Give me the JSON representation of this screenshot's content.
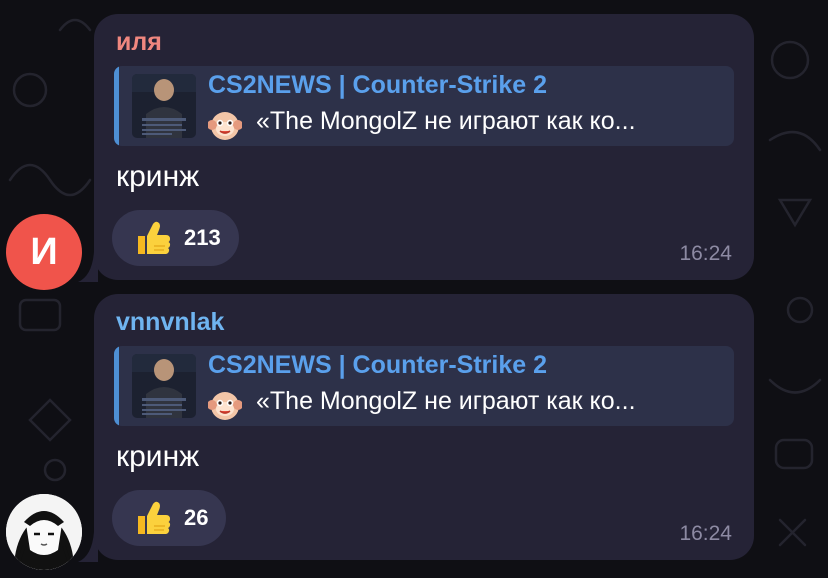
{
  "colors": {
    "background": "#0f0f14",
    "bubble": "#252336",
    "reply_background": "#2d3149",
    "accent_blue": "#5aa0ec",
    "timestamp": "#8d8aa3"
  },
  "messages": [
    {
      "sender": "иля",
      "sender_color": "#f0877f",
      "avatar_initial": "И",
      "avatar_color": "#f0544b",
      "reply": {
        "channel": "CS2NEWS | Counter-Strike 2",
        "emoji": "monkey-face-icon",
        "text": "«The MongolZ не играют как ко..."
      },
      "text": "кринж",
      "reaction": {
        "emoji": "thumbs-up-icon",
        "count": "213"
      },
      "time": "16:24"
    },
    {
      "sender": "vnnvnlak",
      "sender_color": "#6fb4f0",
      "avatar_initial": "",
      "reply": {
        "channel": "CS2NEWS | Counter-Strike 2",
        "emoji": "monkey-face-icon",
        "text": "«The MongolZ не играют как ко..."
      },
      "text": "кринж",
      "reaction": {
        "emoji": "thumbs-up-icon",
        "count": "26"
      },
      "time": "16:24"
    }
  ]
}
